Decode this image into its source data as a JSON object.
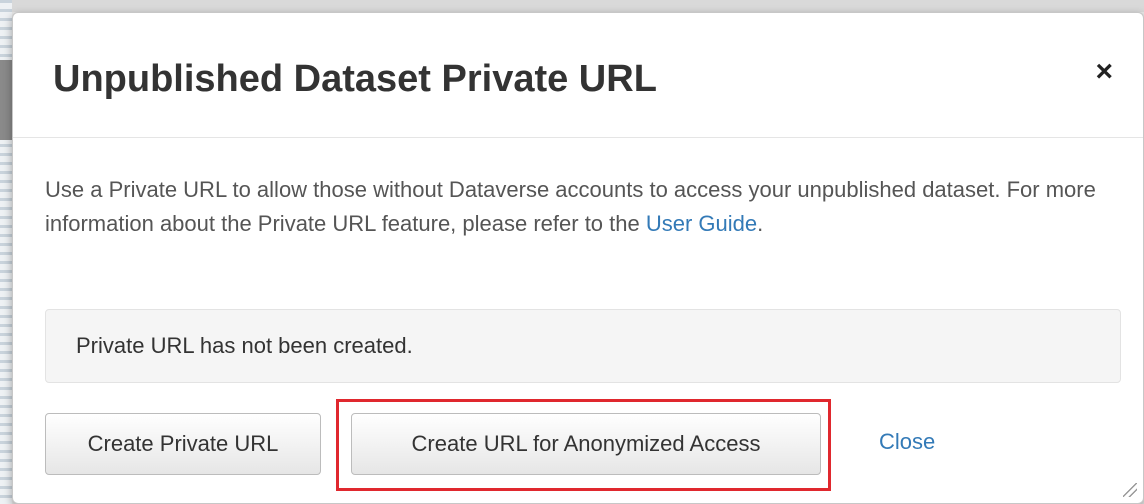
{
  "dialog": {
    "title": "Unpublished Dataset Private URL",
    "close_icon": "×",
    "intro_text": "Use a Private URL to allow those without Dataverse accounts to access your unpublished dataset. For more information about the Private URL feature, please refer to the ",
    "user_guide_link": "User Guide",
    "intro_suffix": ".",
    "status_message": "Private URL has not been created.",
    "buttons": {
      "create_private_url": "Create Private URL",
      "create_anonymized_url": "Create URL for Anonymized Access",
      "close": "Close"
    }
  },
  "icons": {
    "close": "close-icon",
    "resize": "resize-handle-icon"
  },
  "colors": {
    "link": "#337ab7",
    "highlight": "#e0282e",
    "title": "#333333",
    "text": "#555555"
  }
}
